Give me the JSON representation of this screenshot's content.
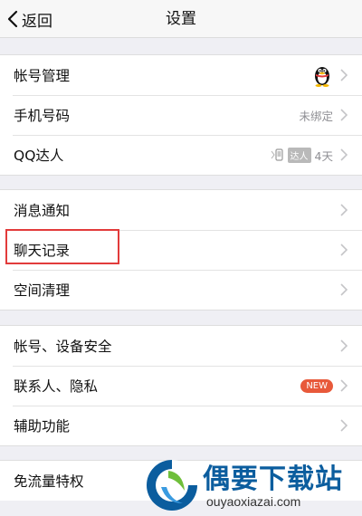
{
  "nav": {
    "back_label": "返回",
    "title": "设置"
  },
  "group1": {
    "account": {
      "label": "帐号管理",
      "icon": "qq-penguin-icon"
    },
    "phone": {
      "label": "手机号码",
      "value": "未绑定"
    },
    "daren": {
      "label": "QQ达人",
      "badge": "达人",
      "days": "4天"
    }
  },
  "group2": {
    "notify": {
      "label": "消息通知"
    },
    "chat": {
      "label": "聊天记录"
    },
    "space": {
      "label": "空间清理"
    }
  },
  "group3": {
    "security": {
      "label": "帐号、设备安全"
    },
    "privacy": {
      "label": "联系人、隐私",
      "badge": "NEW"
    },
    "assist": {
      "label": "辅助功能"
    }
  },
  "group4": {
    "traffic": {
      "label": "免流量特权"
    }
  },
  "watermark": {
    "title": "偶要下载站",
    "url": "ouyaoxiazai.com"
  },
  "colors": {
    "accent_red": "#e23b3b",
    "badge_new": "#e8593a",
    "watermark_blue": "#0b5d9e"
  }
}
